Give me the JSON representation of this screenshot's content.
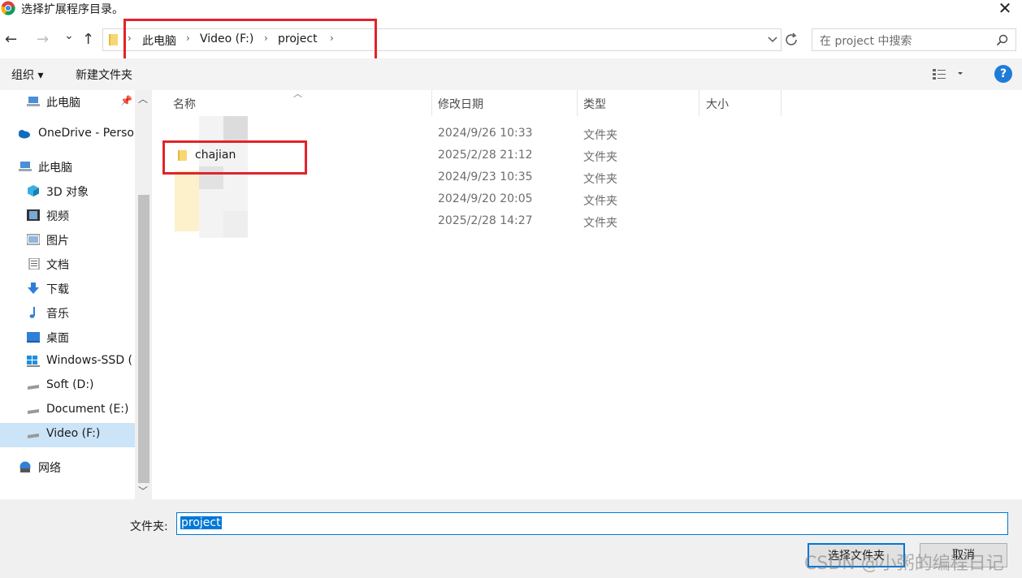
{
  "window": {
    "title": "选择扩展程序目录。",
    "close_icon": "✕"
  },
  "nav_buttons": {
    "back": "←",
    "forward": "→",
    "recent": "⌄",
    "up": "↑"
  },
  "address_bar": {
    "crumbs": [
      "此电脑",
      "Video (F:)",
      "project"
    ],
    "dropdown_icon": "chevron-down-icon",
    "refresh_icon": "refresh-icon"
  },
  "search": {
    "placeholder": "在 project 中搜索"
  },
  "toolbar": {
    "organize": "组织 ▾",
    "new_folder": "新建文件夹",
    "view_icon": "view-options-icon",
    "help": "?"
  },
  "nav_pane": {
    "items": [
      {
        "label": "此电脑",
        "icon": "pc-icon",
        "pinned": true
      },
      {
        "label": "OneDrive - Perso",
        "icon": "cloud-icon"
      },
      {
        "label": "此电脑",
        "icon": "pc-icon"
      },
      {
        "label": "3D 对象",
        "icon": "cube-icon"
      },
      {
        "label": "视频",
        "icon": "film-icon"
      },
      {
        "label": "图片",
        "icon": "picture-icon"
      },
      {
        "label": "文档",
        "icon": "document-icon"
      },
      {
        "label": "下载",
        "icon": "download-icon"
      },
      {
        "label": "音乐",
        "icon": "music-icon"
      },
      {
        "label": "桌面",
        "icon": "desktop-icon"
      },
      {
        "label": "Windows-SSD (",
        "icon": "windows-drive-icon"
      },
      {
        "label": "Soft (D:)",
        "icon": "drive-icon"
      },
      {
        "label": "Document (E:)",
        "icon": "drive-icon"
      },
      {
        "label": "Video (F:)",
        "icon": "drive-icon",
        "selected": true
      },
      {
        "label": "网络",
        "icon": "network-icon"
      }
    ]
  },
  "columns": {
    "name": "名称",
    "modified": "修改日期",
    "type": "类型",
    "size": "大小"
  },
  "files": [
    {
      "name": "",
      "modified": "2024/9/26 10:33",
      "type": "文件夹"
    },
    {
      "name": "chajian",
      "modified": "2025/2/28 21:12",
      "type": "文件夹"
    },
    {
      "name": "",
      "modified": "2024/9/23 10:35",
      "type": "文件夹"
    },
    {
      "name": "",
      "modified": "2024/9/20 20:05",
      "type": "文件夹"
    },
    {
      "name": "",
      "modified": "2025/2/28 14:27",
      "type": "文件夹"
    }
  ],
  "footer": {
    "folder_label": "文件夹:",
    "folder_value": "project",
    "select_button": "选择文件夹",
    "cancel_button": "取消"
  },
  "watermark": "CSDN @小粥的编程日记",
  "colors": {
    "accent": "#0078d7",
    "highlight_box": "#e0242a",
    "selected_nav": "#cce4f7"
  }
}
